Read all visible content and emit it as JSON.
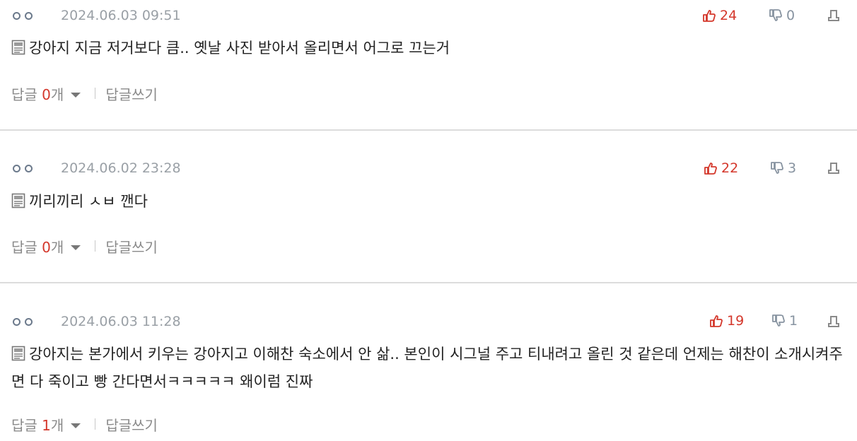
{
  "icons": {
    "avatar": "avatar-circles-icon",
    "like": "thumbs-up-icon",
    "dislike": "thumbs-down-icon",
    "report": "report-icon",
    "document": "document-icon",
    "expand": "caret-down-icon"
  },
  "colors": {
    "like": "#d4372b",
    "dislike": "#8793a0",
    "meta": "#9aa0a6",
    "reply_num": "#d4372b"
  },
  "labels": {
    "reply_prefix": "답글 ",
    "reply_suffix": "개",
    "write_reply": "답글쓰기"
  },
  "comments": [
    {
      "date": "2024.06.03 09:51",
      "likes": "24",
      "dislikes": "0",
      "text": "강아지 지금 저거보다 큼.. 옛날 사진 받아서 올리면서 어그로 끄는거",
      "reply_count": "0"
    },
    {
      "date": "2024.06.02 23:28",
      "likes": "22",
      "dislikes": "3",
      "text": "끼리끼리 ㅅㅂ 깬다",
      "reply_count": "0"
    },
    {
      "date": "2024.06.03 11:28",
      "likes": "19",
      "dislikes": "1",
      "text": "강아지는 본가에서 키우는 강아지고 이해찬 숙소에서 안 삶.. 본인이 시그널 주고 티내려고 올린 것 같은데 언제는 해찬이 소개시켜주면 다 죽이고 빵 간다면서ㅋㅋㅋㅋㅋ 왜이럼 진짜",
      "reply_count": "1"
    }
  ]
}
